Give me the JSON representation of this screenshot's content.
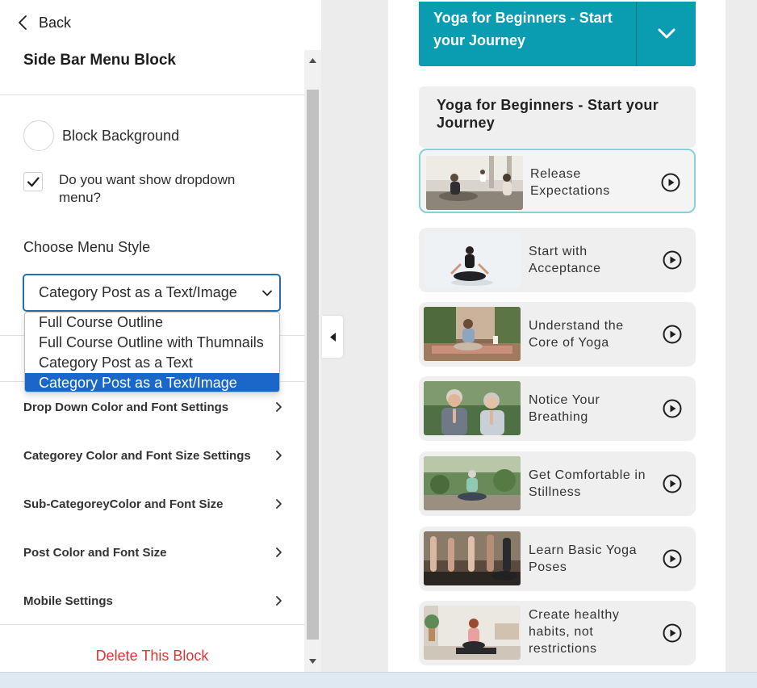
{
  "panel": {
    "back_label": "Back",
    "title": "Side Bar Menu Block",
    "block_background_label": "Block Background",
    "dropdown_question": "Do you want show dropdown menu?",
    "dropdown_checked": true,
    "choose_menu_style_label": "Choose Menu Style",
    "menu_style_selected": "Category Post as a Text/Image",
    "menu_style_options": [
      "Full Course Outline",
      "Full Course Outline with Thumnails",
      "Category Post as a Text",
      "Category Post as a Text/Image"
    ],
    "sections": [
      "Drop Down Color and Font Settings",
      "Categorey Color and Font Size Settings",
      "Sub-CategoreyColor and Font Size",
      "Post Color and Font Size",
      "Mobile Settings"
    ],
    "delete_label": "Delete This Block"
  },
  "preview": {
    "header_title": "Yoga for Beginners - Start your Journey",
    "category_title": "Yoga for Beginners - Start your Journey",
    "posts": [
      {
        "title": "Release Expectations"
      },
      {
        "title": "Start with Acceptance"
      },
      {
        "title": "Understand the Core of Yoga"
      },
      {
        "title": "Notice Your Breathing"
      },
      {
        "title": "Get Comfortable in Stillness"
      },
      {
        "title": "Learn Basic Yoga Poses"
      },
      {
        "title": "Create healthy habits, not restrictions"
      }
    ]
  },
  "colors": {
    "accent": "#0a9cb0",
    "select_focus": "#2271b1",
    "option_selected": "#1a67c9",
    "delete": "#d63638"
  }
}
